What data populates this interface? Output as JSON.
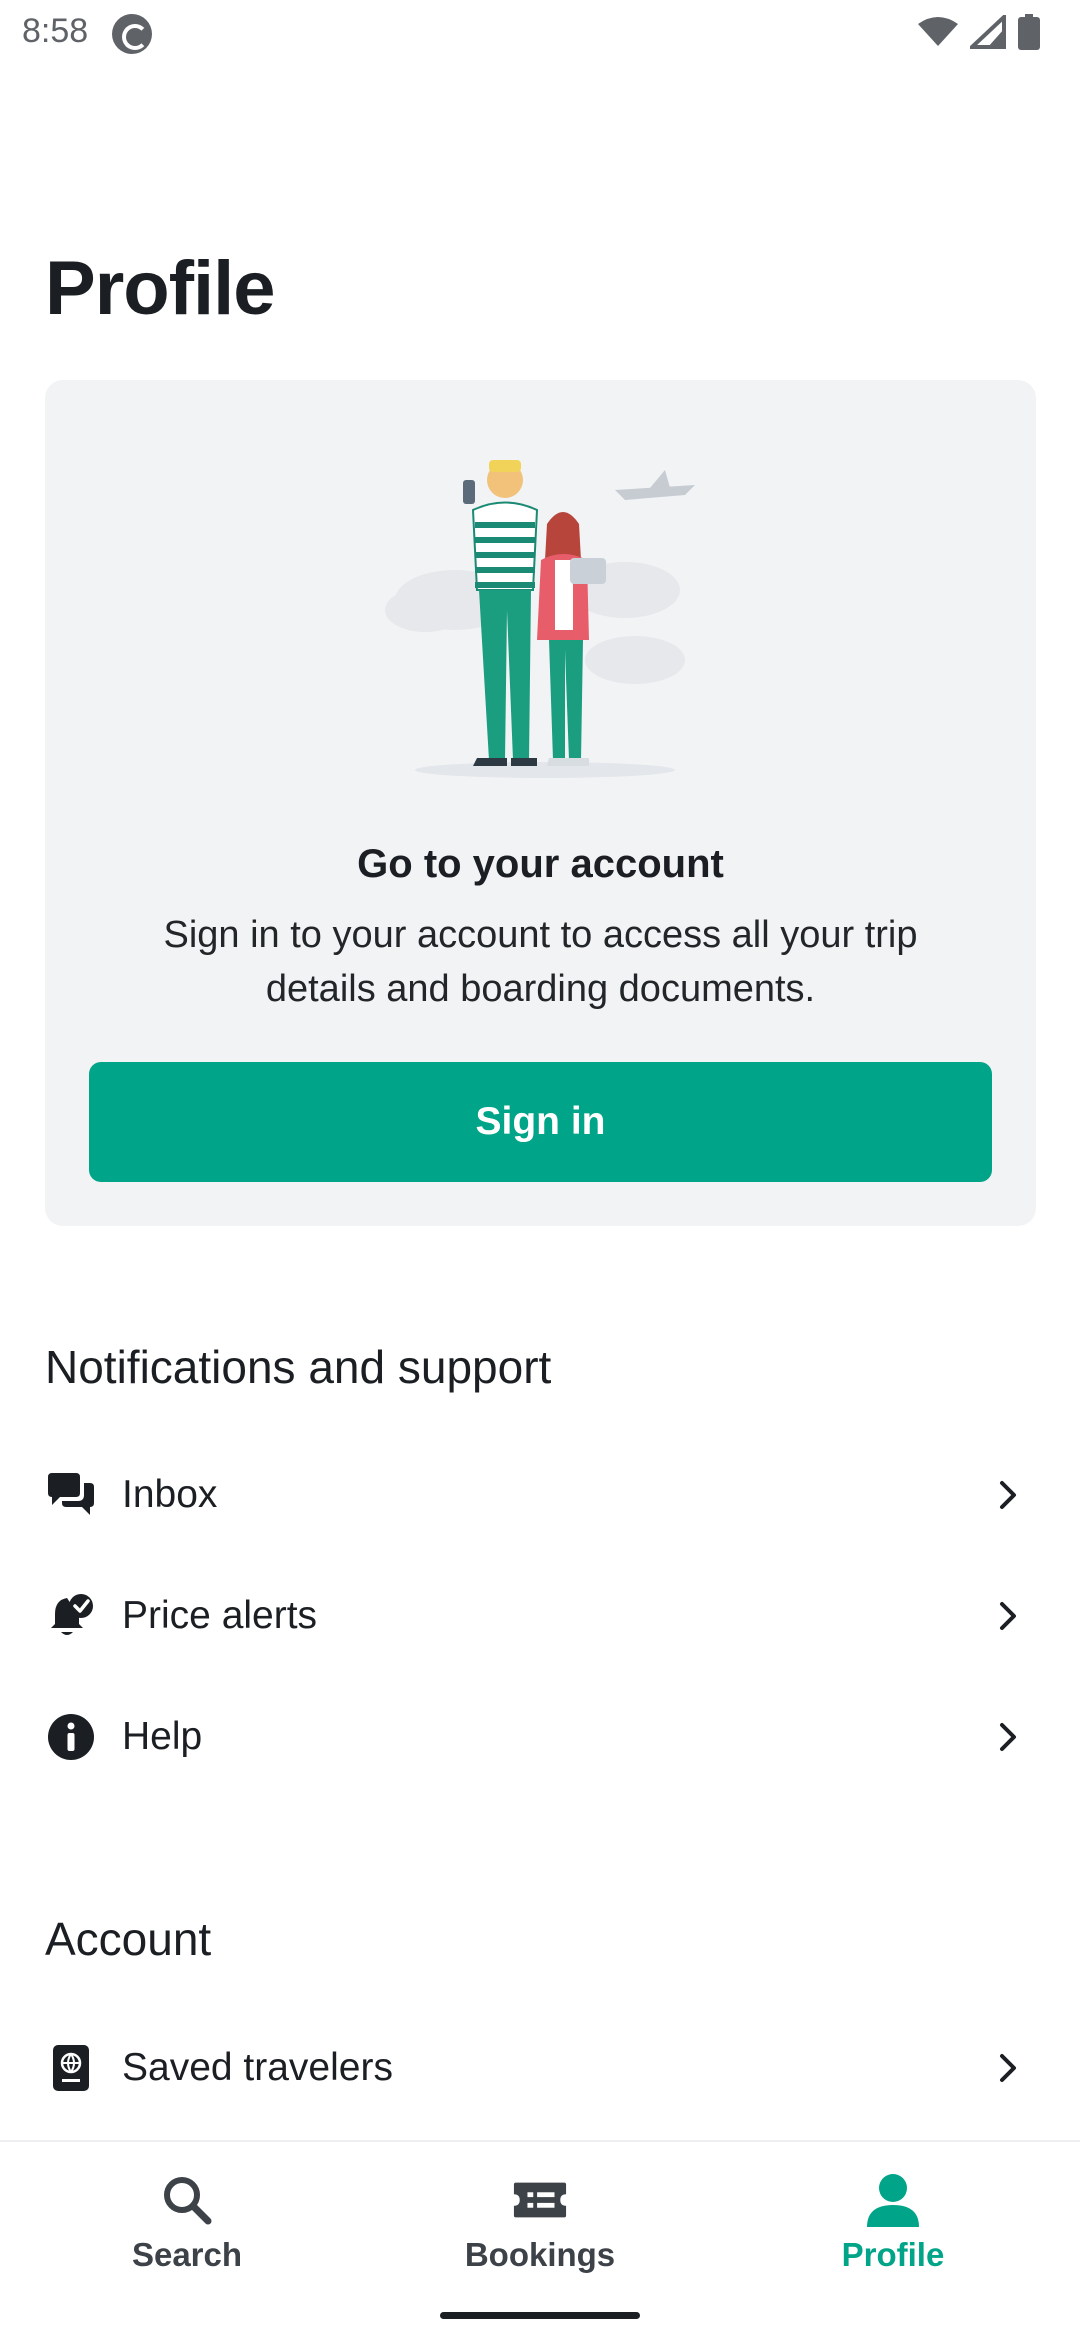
{
  "status_bar": {
    "time": "8:58",
    "icons": [
      "app-notification-icon",
      "wifi-icon",
      "signal-icon",
      "battery-icon"
    ]
  },
  "page": {
    "title": "Profile"
  },
  "account_card": {
    "illustration": "travelers-illustration",
    "heading": "Go to your account",
    "text": "Sign in to your account to access all your trip details and boarding documents.",
    "button_label": "Sign in"
  },
  "notifications_section": {
    "title": "Notifications and support",
    "items": [
      {
        "label": "Inbox",
        "icon": "chat-bubbles-icon"
      },
      {
        "label": "Price alerts",
        "icon": "bell-check-icon"
      },
      {
        "label": "Help",
        "icon": "info-icon"
      }
    ]
  },
  "account_section": {
    "title": "Account",
    "items": [
      {
        "label": "Saved travelers",
        "icon": "passport-icon"
      }
    ]
  },
  "bottom_nav": {
    "tabs": [
      {
        "label": "Search",
        "icon": "search-icon",
        "active": false
      },
      {
        "label": "Bookings",
        "icon": "ticket-icon",
        "active": false
      },
      {
        "label": "Profile",
        "icon": "person-icon",
        "active": true
      }
    ]
  },
  "colors": {
    "accent": "#00a488",
    "card_background": "#f2f3f5",
    "text": "#1b1f23"
  }
}
